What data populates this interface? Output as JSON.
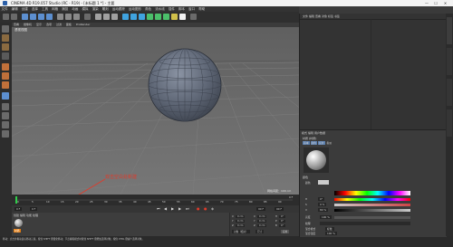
{
  "window": {
    "title": "CINEMA 4D R19.057 Studio (RC - R19) - [未标题 1 *] - 主要",
    "buttons": [
      "—",
      "☐",
      "✕"
    ]
  },
  "menubar": {
    "items": [
      "文件",
      "编辑",
      "创建",
      "选择",
      "工具",
      "网格",
      "捕捉",
      "动画",
      "模拟",
      "渲染",
      "雕刻",
      "运动跟踪",
      "运动图形",
      "角色",
      "流水线",
      "插件",
      "脚本",
      "窗口",
      "帮助"
    ]
  },
  "viewport": {
    "menu": [
      "查看",
      "摄像机",
      "显示",
      "选项",
      "过滤",
      "面板",
      "ProRender"
    ],
    "label": "透视视图",
    "footer": "网格间距：100 cm"
  },
  "timeline": {
    "ticks": [
      "0",
      "5",
      "10",
      "15",
      "20",
      "25",
      "30",
      "35",
      "40",
      "45",
      "50",
      "55",
      "60",
      "65",
      "70",
      "75",
      "80",
      "85",
      "90"
    ],
    "end_frame": "0 F"
  },
  "playbar": {
    "start": "0 F",
    "current": "0 F",
    "end": "90 F",
    "end2": "90 F"
  },
  "annotation": {
    "text": "双击空白处新建"
  },
  "material_panel": {
    "menu": [
      "创建",
      "编辑",
      "功能",
      "纹理"
    ],
    "swatch_label": "材质"
  },
  "coords": {
    "rows": [
      [
        "X",
        "0 cm",
        "X",
        "0 cm",
        "H",
        "0°"
      ],
      [
        "Y",
        "0 cm",
        "Y",
        "0 cm",
        "P",
        "0°"
      ],
      [
        "Z",
        "0 cm",
        "Z",
        "0 cm",
        "B",
        "0°"
      ]
    ],
    "dropdown1": "对象（相对）",
    "dropdown2": "尺寸",
    "apply": "应用"
  },
  "status": {
    "text": "移动：点击并拖动鼠标移动元素。按住 SHIFT 键量化移动；节点编辑模式时按住 SHIFT 键增加选择对象；按住 CTRL 键减少选择对象。"
  },
  "object_manager": {
    "menu": [
      "文件",
      "编辑",
      "查看",
      "对象",
      "标签",
      "书签"
    ]
  },
  "attribute_manager": {
    "tabs": [
      "模式",
      "编辑",
      "用户数据"
    ],
    "material_name": "材质 [材质]",
    "subtabs": [
      "基本",
      "颜色",
      "反射",
      "指派"
    ],
    "section": "颜色",
    "fields": [
      {
        "label": "颜色",
        "value": ""
      },
      {
        "label": "H",
        "value": "0°"
      },
      {
        "label": "S",
        "value": "0 %"
      },
      {
        "label": "V",
        "value": "80 %"
      },
      {
        "label": "亮度",
        "value": "100 %"
      },
      {
        "label": "纹理",
        "value": ""
      },
      {
        "label": "混合模式",
        "value": "标准"
      },
      {
        "label": "混合强度",
        "value": "100 %"
      }
    ]
  },
  "colors": {
    "accent": "#e07a10",
    "annotation": "#e03a2a",
    "viewport_bg": "#6b6b6b",
    "sphere": "#5a6270"
  }
}
